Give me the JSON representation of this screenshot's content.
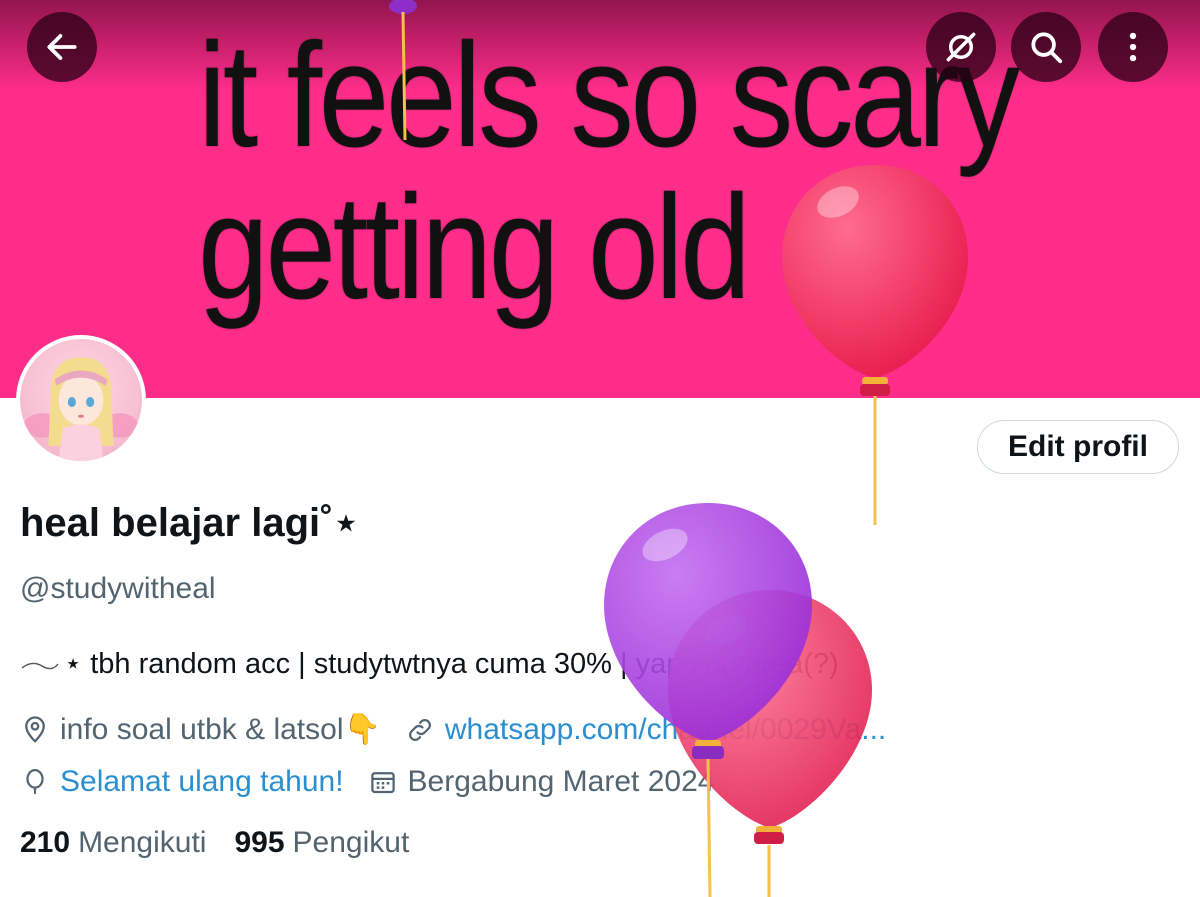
{
  "banner": {
    "line1": "it feels so scary",
    "line2": "getting old",
    "background_color": "#fe2d8a"
  },
  "toolbar": {
    "back_icon": "arrow-left-icon",
    "offline_icon": "no-signal-icon",
    "search_icon": "search-icon",
    "more_icon": "more-vertical-icon"
  },
  "profile": {
    "edit_label": "Edit profil",
    "name": "heal belajar lagi˚⋆",
    "handle": "@studywitheal",
    "bio": "⋆ tbh random acc | studytwtnya cuma 30% | yapping area(?)",
    "location": "info soal utbk & latsol👇",
    "website": "whatsapp.com/channel/0029Va...",
    "birthday": "Selamat ulang tahun!",
    "joined": "Bergabung Maret 2024",
    "following_count": "210",
    "following_label": "Mengikuti",
    "followers_count": "995",
    "followers_label": "Pengikut"
  },
  "colors": {
    "accent_link": "#2b8fcf",
    "muted_text": "#536471"
  }
}
